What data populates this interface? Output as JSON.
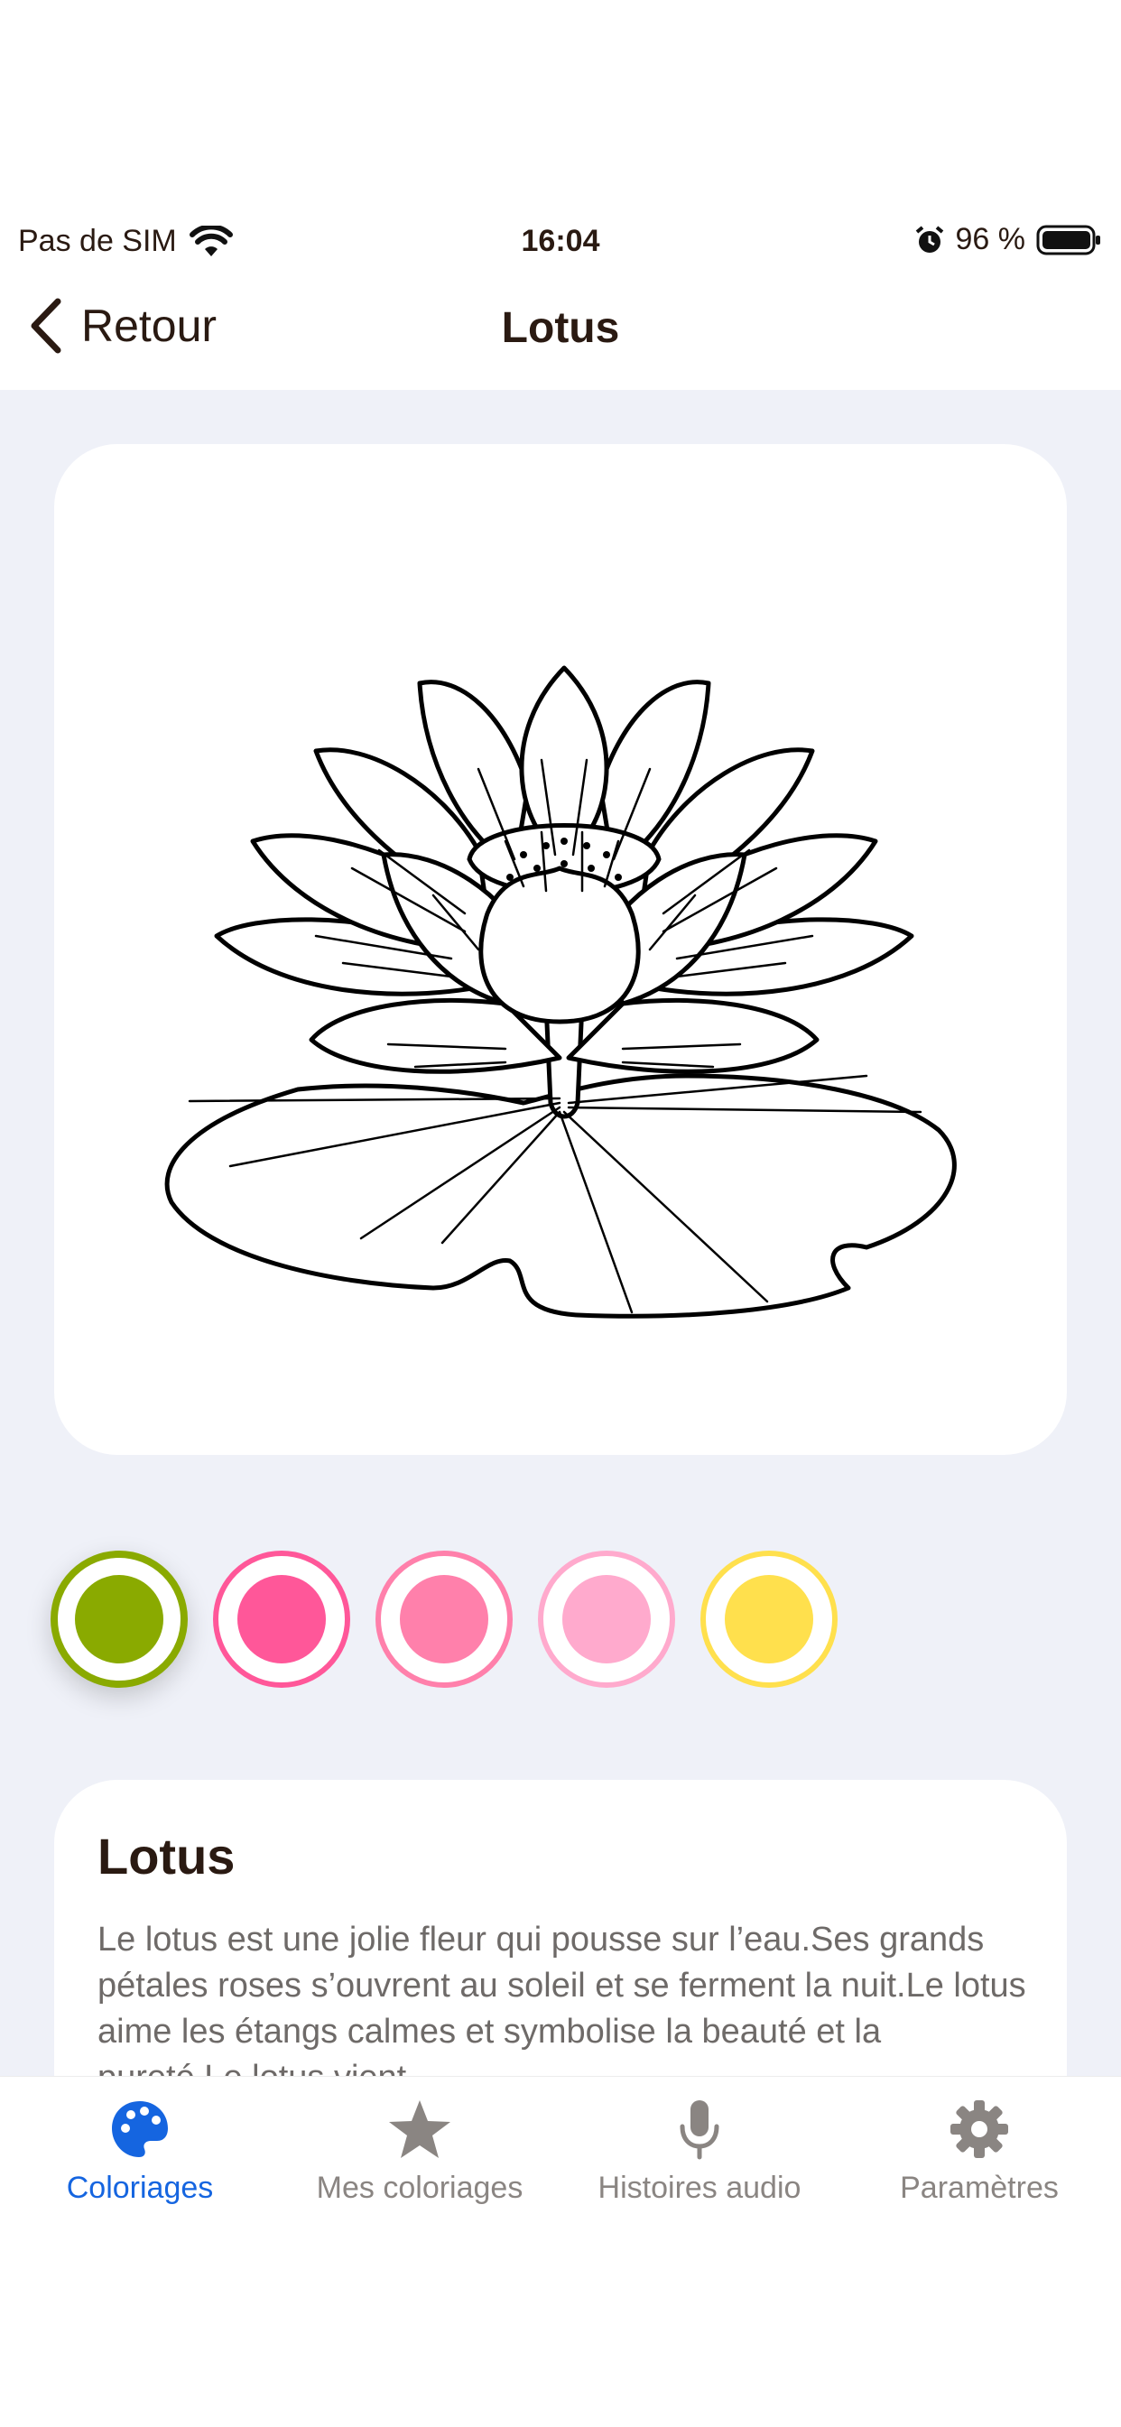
{
  "status_bar": {
    "carrier": "Pas de SIM",
    "time": "16:04",
    "battery": "96 %"
  },
  "nav": {
    "back_label": "Retour",
    "title": "Lotus"
  },
  "palette": {
    "colors": [
      {
        "hex": "#8aaa00",
        "selected": true
      },
      {
        "hex": "#ff5799",
        "selected": false
      },
      {
        "hex": "#ff80ab",
        "selected": false
      },
      {
        "hex": "#ffaacd",
        "selected": false
      },
      {
        "hex": "#ffe04d",
        "selected": false
      }
    ]
  },
  "info": {
    "title": "Lotus",
    "description": "Le lotus est une jolie fleur qui pousse sur l’eau.Ses grands pétales roses s’ouvrent au soleil et se ferment la nuit.Le lotus aime les étangs calmes et symbolise la beauté et la pureté.Le lotus vient"
  },
  "tabs": [
    {
      "label": "Coloriages",
      "icon": "palette-icon",
      "active": true
    },
    {
      "label": "Mes coloriages",
      "icon": "star-icon",
      "active": false
    },
    {
      "label": "Histoires audio",
      "icon": "microphone-icon",
      "active": false
    },
    {
      "label": "Paramètres",
      "icon": "gear-icon",
      "active": false
    }
  ]
}
